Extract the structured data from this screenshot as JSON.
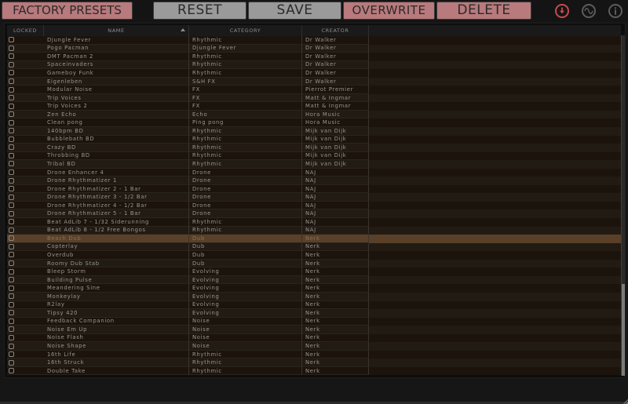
{
  "toolbar": {
    "factory_presets_label": "FACTORY PRESETS",
    "reset_label": "RESET",
    "save_label": "SAVE",
    "overwrite_label": "OVERWRITE",
    "delete_label": "DELETE",
    "icons": [
      "download-icon",
      "waveform-icon",
      "info-icon"
    ],
    "colors": {
      "pink": "#b87a7c",
      "gray": "#9a9a9a",
      "accent_red": "#c94a4a"
    }
  },
  "table": {
    "columns": {
      "locked": "LOCKED",
      "name": "NAME",
      "category": "CATEGORY",
      "creator": "CREATOR"
    },
    "sort_column": "NAME",
    "sort_direction": "ascending",
    "selected_index": 24,
    "selected_color": "#5a4028",
    "scroll": {
      "thumb_start_fraction": 0.73,
      "thumb_size_fraction": 0.27
    },
    "rows": [
      {
        "name": "Djungle Fever",
        "category": "Rhythmic",
        "creator": "Dr Walker",
        "locked": false
      },
      {
        "name": "Pogo Pacman",
        "category": "Djungle Fever",
        "creator": "Dr Walker",
        "locked": false
      },
      {
        "name": "DMT Pacman 2",
        "category": "Rhythmic",
        "creator": "Dr Walker",
        "locked": false
      },
      {
        "name": "Spaceinvaders",
        "category": "Rhythmic",
        "creator": "Dr Walker",
        "locked": false
      },
      {
        "name": "Gameboy Funk",
        "category": "Rhythmic",
        "creator": "Dr Walker",
        "locked": false
      },
      {
        "name": "Eigenleben",
        "category": "S&H FX",
        "creator": "Dr Walker",
        "locked": false
      },
      {
        "name": "Modular Noise",
        "category": "FX",
        "creator": "Pierrot Premier",
        "locked": false
      },
      {
        "name": "Trip Voices",
        "category": "FX",
        "creator": "Matt & Ingmar",
        "locked": false
      },
      {
        "name": "Trip Voices 2",
        "category": "FX",
        "creator": "Matt & Ingmar",
        "locked": false
      },
      {
        "name": "Zen Echo",
        "category": "Echo",
        "creator": "Hora Music",
        "locked": false
      },
      {
        "name": "Clean pong",
        "category": "Ping pong",
        "creator": "Hora Music",
        "locked": false
      },
      {
        "name": "140bpm BD",
        "category": "Rhythmic",
        "creator": "Mijk van Dijk",
        "locked": false
      },
      {
        "name": "Bubblebath BD",
        "category": "Rhythmic",
        "creator": "Mijk van Dijk",
        "locked": false
      },
      {
        "name": "Crazy BD",
        "category": "Rhythmic",
        "creator": "Mijk van Dijk",
        "locked": false
      },
      {
        "name": "Throbbing BD",
        "category": "Rhythmic",
        "creator": "Mijk van Dijk",
        "locked": false
      },
      {
        "name": "Tribal BD",
        "category": "Rhythmic",
        "creator": "Mijk van Dijk",
        "locked": false
      },
      {
        "name": "Drone Enhancer 4",
        "category": "Drone",
        "creator": "NAJ",
        "locked": false
      },
      {
        "name": "Drone Rhythmatizer 1",
        "category": "Drone",
        "creator": "NAJ",
        "locked": false
      },
      {
        "name": "Drone Rhythmatizer 2 - 1 Bar",
        "category": "Drone",
        "creator": "NAJ",
        "locked": false
      },
      {
        "name": "Drone Rhythmatizer 3 - 1/2 Bar",
        "category": "Drone",
        "creator": "NAJ",
        "locked": false
      },
      {
        "name": "Drone Rhythmatizer 4 - 1/2 Bar",
        "category": "Drone",
        "creator": "NAJ",
        "locked": false
      },
      {
        "name": "Drone Rhythmatizer 5 - 1 Bar",
        "category": "Drone",
        "creator": "NAJ",
        "locked": false
      },
      {
        "name": "Beat AdLib 7 - 1/32 Siderunning",
        "category": "Rhythmic",
        "creator": "NAJ",
        "locked": false
      },
      {
        "name": "Beat AdLib 8 - 1/2 Free Bongos",
        "category": "Rhythmic",
        "creator": "NAJ",
        "locked": false
      },
      {
        "name": "Beach Dub",
        "category": "Dub",
        "creator": "Nerk",
        "locked": false
      },
      {
        "name": "Copterlay",
        "category": "Dub",
        "creator": "Nerk",
        "locked": false
      },
      {
        "name": "Overdub",
        "category": "Dub",
        "creator": "Nerk",
        "locked": false
      },
      {
        "name": "Roomy Dub Stab",
        "category": "Dub",
        "creator": "Nerk",
        "locked": false
      },
      {
        "name": "Bleep Storm",
        "category": "Evolving",
        "creator": "Nerk",
        "locked": false
      },
      {
        "name": "Building Pulse",
        "category": "Evolving",
        "creator": "Nerk",
        "locked": false
      },
      {
        "name": "Meandering Sine",
        "category": "Evolving",
        "creator": "Nerk",
        "locked": false
      },
      {
        "name": "Monkeylay",
        "category": "Evolving",
        "creator": "Nerk",
        "locked": false
      },
      {
        "name": "R2lay",
        "category": "Evolving",
        "creator": "Nerk",
        "locked": false
      },
      {
        "name": "Tipsy 420",
        "category": "Evolving",
        "creator": "Nerk",
        "locked": false
      },
      {
        "name": "Feedback Companion",
        "category": "Noise",
        "creator": "Nerk",
        "locked": false
      },
      {
        "name": "Noise Em Up",
        "category": "Noise",
        "creator": "Nerk",
        "locked": false
      },
      {
        "name": "Noise Flash",
        "category": "Noise",
        "creator": "Nerk",
        "locked": false
      },
      {
        "name": "Noise Shape",
        "category": "Noise",
        "creator": "Nerk",
        "locked": false
      },
      {
        "name": "16th Life",
        "category": "Rhythmic",
        "creator": "Nerk",
        "locked": false
      },
      {
        "name": "16th Struck",
        "category": "Rhythmic",
        "creator": "Nerk",
        "locked": false
      },
      {
        "name": "Double Take",
        "category": "Rhythmic",
        "creator": "Nerk",
        "locked": false
      }
    ]
  }
}
